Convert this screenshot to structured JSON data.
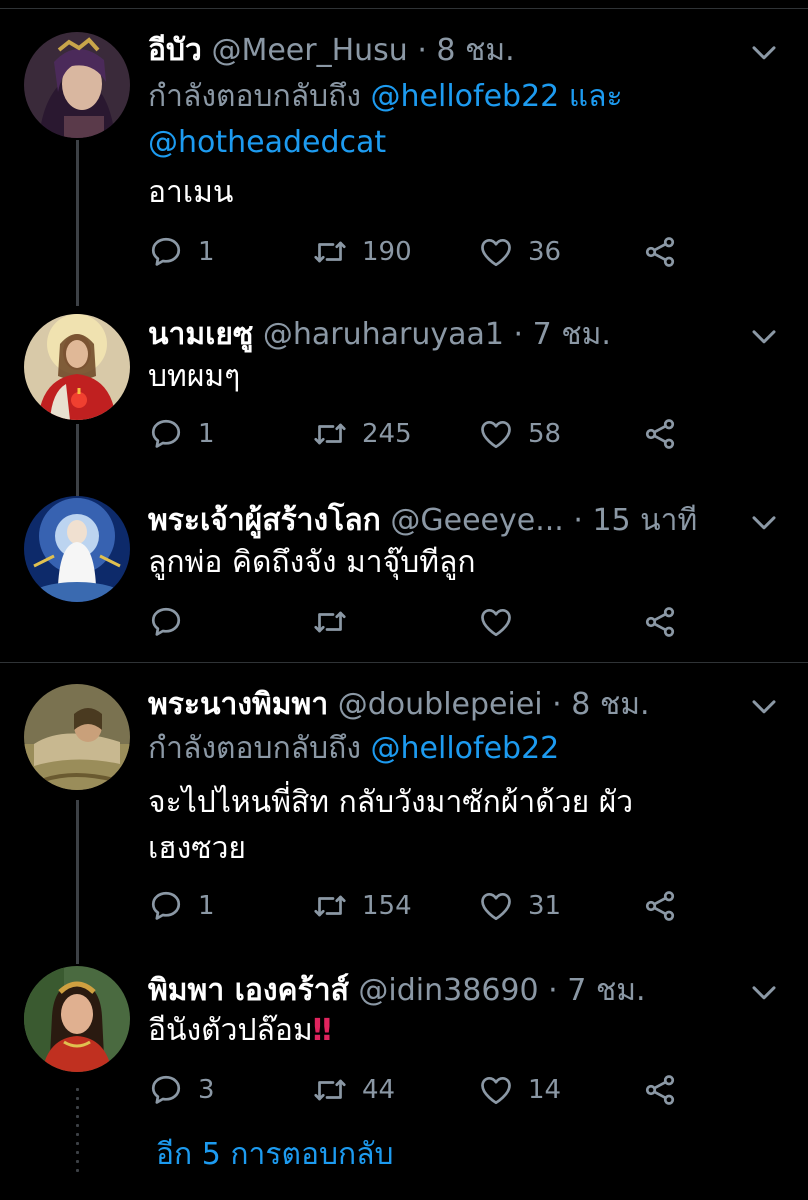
{
  "tweets": [
    {
      "name": "อีบัว",
      "handle": "@Meer_Husu",
      "sep": " · ",
      "time": "8 ชม.",
      "replying_prefix": "กำลังตอบกลับถึง ",
      "mention1": "@hellofeb22",
      "replying_mid": " และ",
      "mention2": "@hotheadedcat",
      "text": "อาเมน",
      "replies": "1",
      "retweets": "190",
      "likes": "36"
    },
    {
      "name": "นามเยซู",
      "handle": "@haruharuyaa1",
      "sep": " · ",
      "time": "7 ชม.",
      "text": "บทผมๆ",
      "replies": "1",
      "retweets": "245",
      "likes": "58"
    },
    {
      "name": "พระเจ้าผู้สร้างโลก",
      "handle": "@Geeeye...",
      "sep": " · ",
      "time": "15 นาที",
      "text": "ลูกพ่อ คิดถึงจัง มาจุ๊บทีลูก",
      "replies": "",
      "retweets": "",
      "likes": ""
    },
    {
      "name": "พระนางพิมพา",
      "handle": "@doublepeiei",
      "sep": " · ",
      "time": "8 ชม.",
      "replying_prefix": "กำลังตอบกลับถึง ",
      "mention1": "@hellofeb22",
      "text_line1": "จะไปไหนพี่สิท กลับวังมาซักผ้าด้วย ผัว",
      "text_line2": "เฮงซวย",
      "replies": "1",
      "retweets": "154",
      "likes": "31"
    },
    {
      "name": "พิมพา เองคร้าส์",
      "handle": "@idin38690",
      "sep": " · ",
      "time": "7 ชม.",
      "text": "อีนังตัวปล๊อม",
      "text_emoji": "‼",
      "replies": "3",
      "retweets": "44",
      "likes": "14"
    }
  ],
  "more_replies": "อีก 5 การตอบกลับ",
  "colors": {
    "background": "#000000",
    "secondary": "#8b98a5",
    "link": "#1d9bf0",
    "divider": "#2f3336"
  },
  "icons": [
    "reply-icon",
    "retweet-icon",
    "like-icon",
    "share-icon",
    "chevron-down-icon"
  ]
}
